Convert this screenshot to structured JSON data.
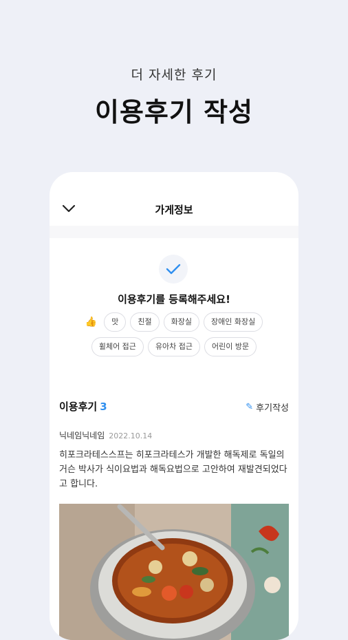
{
  "promo": {
    "subtitle": "더 자세한 후기",
    "title": "이용후기 작성"
  },
  "topbar": {
    "back_icon": "chevron-down-icon",
    "title": "가게정보"
  },
  "empty_state": {
    "icon": "check-icon",
    "prompt": "이용후기를 등록해주세요!"
  },
  "tags": {
    "row1": [
      "맛",
      "친절",
      "화장실",
      "장애인 화장실"
    ],
    "row2": [
      "휠체어 접근",
      "유아차 접근",
      "어린이 방문"
    ]
  },
  "reviews": {
    "title": "이용후기",
    "count": "3",
    "write_label": "후기작성",
    "items": [
      {
        "author": "닉네임닉네임",
        "date": "2022.10.14",
        "body": "히포크라테스스프는 히포크라테스가 개발한 해독제로 독일의 거슨 박사가 식이요법과 해독요법으로 고안하여 재발견되었다고 합니다."
      }
    ]
  },
  "colors": {
    "background": "#eef0f7",
    "accent": "#2f8fef"
  }
}
